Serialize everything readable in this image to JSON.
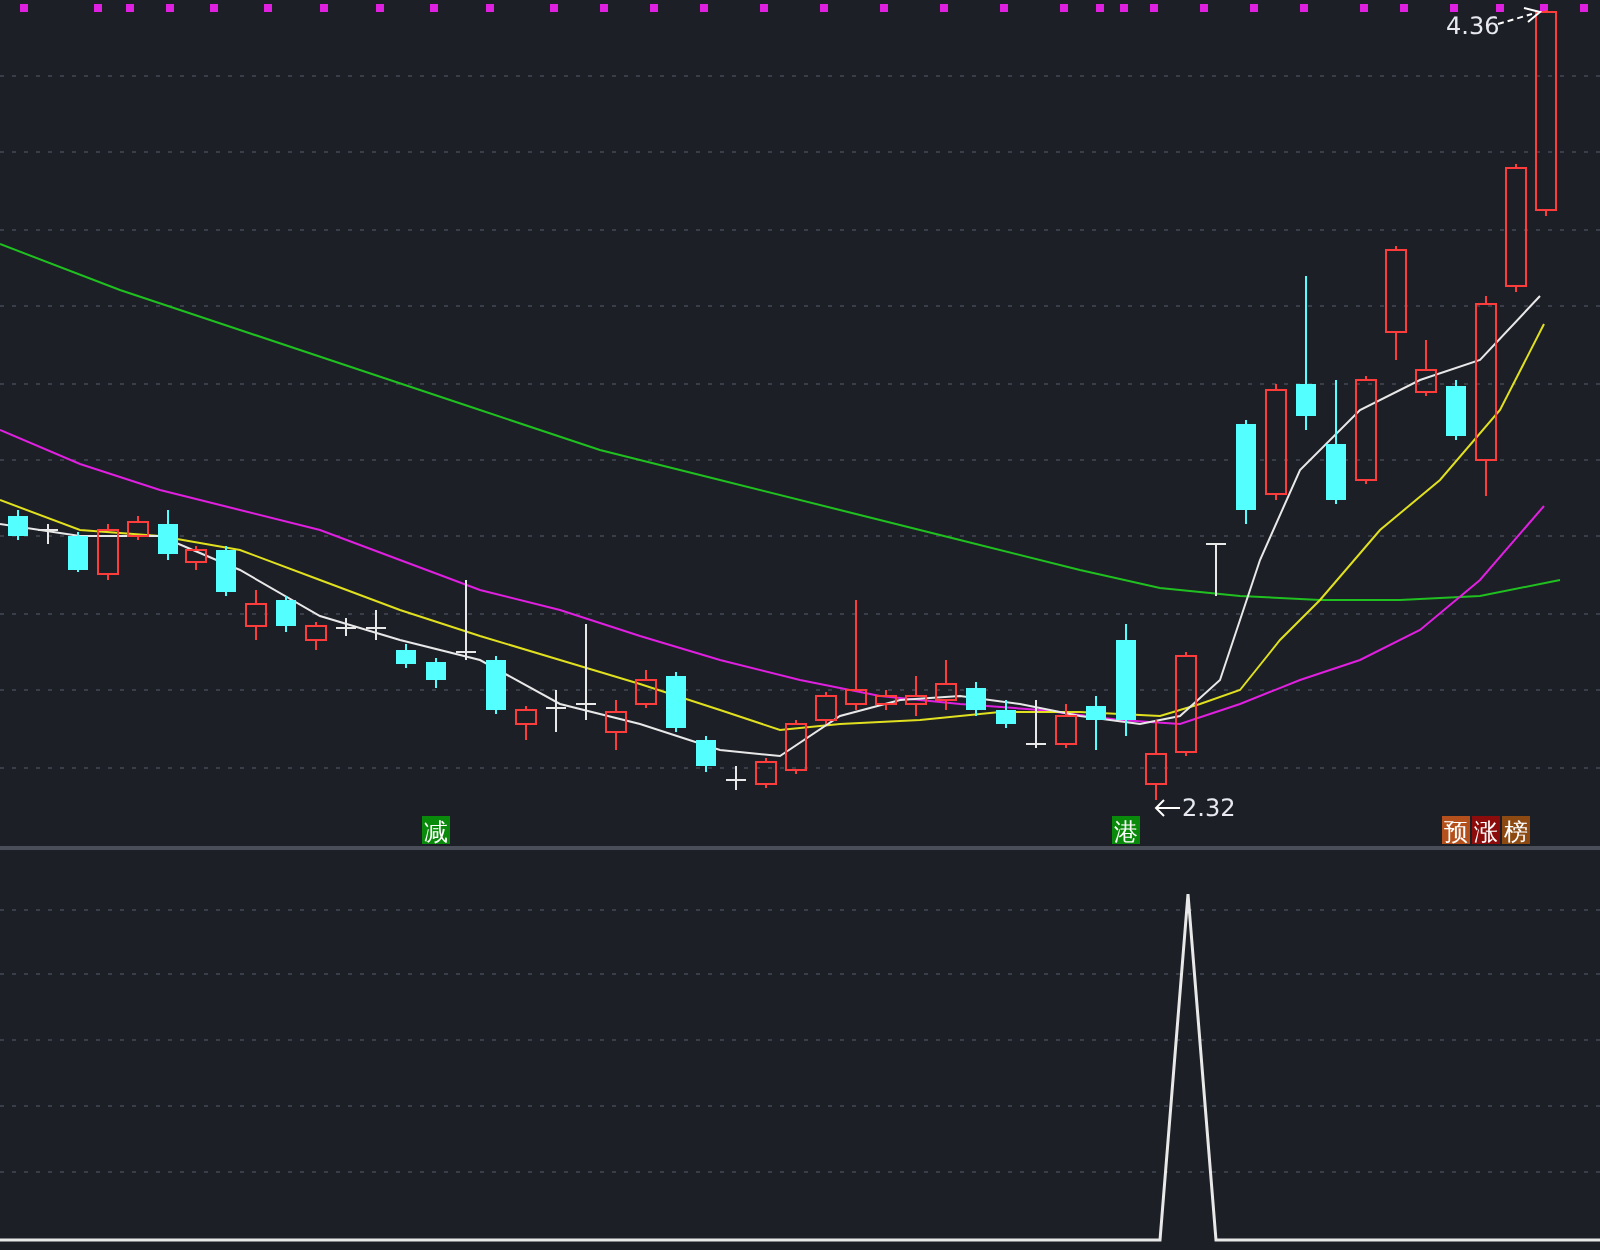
{
  "chart": {
    "price_labels": [
      {
        "kind": "high",
        "text": "4.36"
      },
      {
        "kind": "low",
        "text": "2.32"
      }
    ],
    "signals": [
      {
        "text": "减",
        "color": "#0a8a0a"
      },
      {
        "text": "港",
        "color": "#0a8a0a"
      },
      {
        "text": "预",
        "color": "#b4501c"
      },
      {
        "text": "涨",
        "color": "#8c0c0c"
      },
      {
        "text": "榜",
        "color": "#8c4a12"
      }
    ]
  }
}
